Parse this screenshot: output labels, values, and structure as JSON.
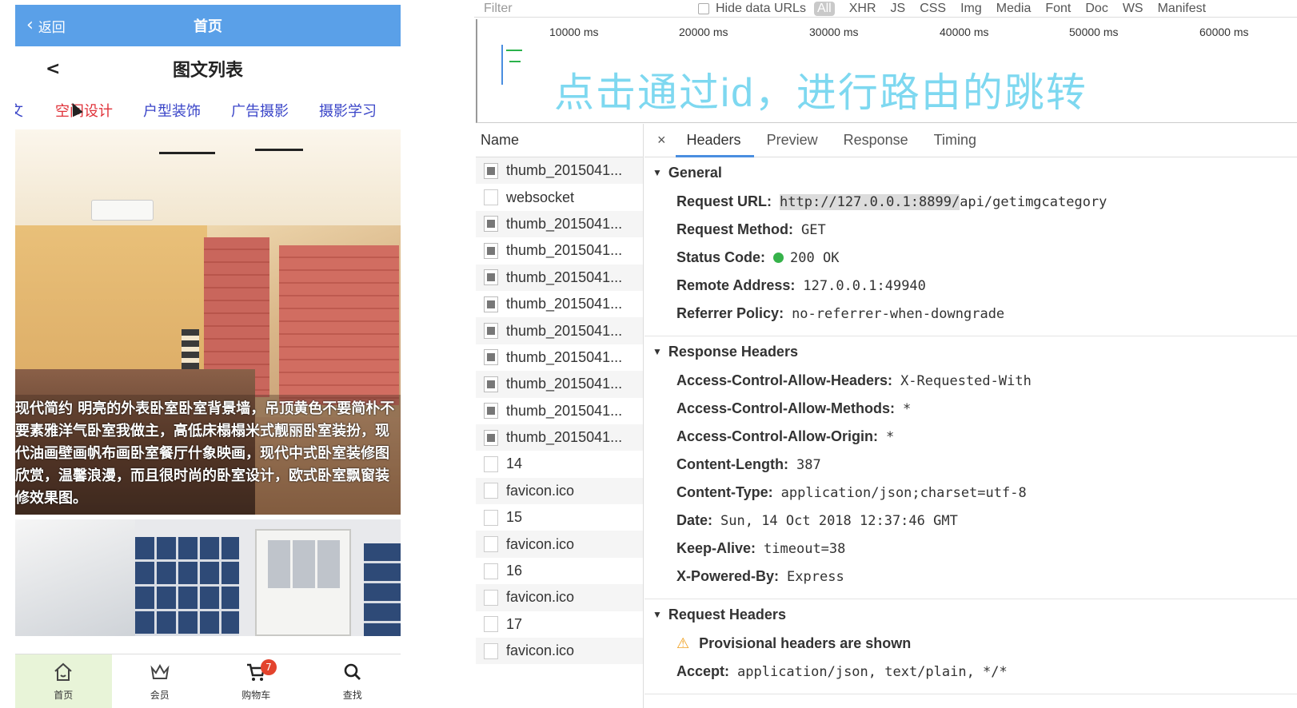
{
  "phone": {
    "navbar": {
      "back_label": "返回",
      "title": "首页"
    },
    "page": {
      "back_label": "<",
      "title": "图文列表"
    },
    "categories": [
      {
        "label": "文"
      },
      {
        "label": "空间设计"
      },
      {
        "label": "户型装饰"
      },
      {
        "label": "广告摄影"
      },
      {
        "label": "摄影学习"
      }
    ],
    "active_category_index": 1,
    "image_caption": "现代简约 明亮的外表卧室卧室背景墙，吊顶黄色不要简朴不要素雅洋气卧室我做主，高低床榻榻米式靓丽卧室装扮，现代油画壁画帆布画卧室餐厅什象映画，现代中式卧室装修图欣赏，温馨浪漫，而且很时尚的卧室设计，欧式卧室飘窗装修效果图。",
    "tabbar": [
      {
        "label": "首页",
        "icon": "home-icon"
      },
      {
        "label": "会员",
        "icon": "crown-icon"
      },
      {
        "label": "购物车",
        "icon": "cart-icon",
        "badge": "7"
      },
      {
        "label": "查找",
        "icon": "search-icon"
      }
    ]
  },
  "devtools": {
    "filter": {
      "placeholder": "Filter",
      "hide_data_urls": "Hide data URLs"
    },
    "types": [
      "All",
      "XHR",
      "JS",
      "CSS",
      "Img",
      "Media",
      "Font",
      "Doc",
      "WS",
      "Manifest"
    ],
    "timeline_ticks": [
      "10000 ms",
      "20000 ms",
      "30000 ms",
      "40000 ms",
      "50000 ms",
      "60000 ms"
    ],
    "overlay_text": "点击通过id，进行路由的跳转",
    "name_header": "Name",
    "requests": [
      {
        "name": "thumb_2015041...",
        "kind": "image"
      },
      {
        "name": "websocket",
        "kind": "plain"
      },
      {
        "name": "thumb_2015041...",
        "kind": "image"
      },
      {
        "name": "thumb_2015041...",
        "kind": "image"
      },
      {
        "name": "thumb_2015041...",
        "kind": "image"
      },
      {
        "name": "thumb_2015041...",
        "kind": "image"
      },
      {
        "name": "thumb_2015041...",
        "kind": "image"
      },
      {
        "name": "thumb_2015041...",
        "kind": "image"
      },
      {
        "name": "thumb_2015041...",
        "kind": "image"
      },
      {
        "name": "thumb_2015041...",
        "kind": "image"
      },
      {
        "name": "thumb_2015041...",
        "kind": "image"
      },
      {
        "name": "14",
        "kind": "plain"
      },
      {
        "name": "favicon.ico",
        "kind": "plain"
      },
      {
        "name": "15",
        "kind": "plain"
      },
      {
        "name": "favicon.ico",
        "kind": "plain"
      },
      {
        "name": "16",
        "kind": "plain"
      },
      {
        "name": "favicon.ico",
        "kind": "plain"
      },
      {
        "name": "17",
        "kind": "plain"
      },
      {
        "name": "favicon.ico",
        "kind": "plain"
      }
    ],
    "detail_tabs": {
      "close": "×",
      "headers": "Headers",
      "preview": "Preview",
      "response": "Response",
      "timing": "Timing"
    },
    "general": {
      "title": "General",
      "request_url_key": "Request URL:",
      "request_url_host": "http://127.0.0.1:8899/",
      "request_url_path": "api/getimgcategory",
      "request_method_key": "Request Method:",
      "request_method": "GET",
      "status_code_key": "Status Code:",
      "status_code": "200 OK",
      "status_color": "#36b24a",
      "remote_address_key": "Remote Address:",
      "remote_address": "127.0.0.1:49940",
      "referrer_policy_key": "Referrer Policy:",
      "referrer_policy": "no-referrer-when-downgrade"
    },
    "response_headers": {
      "title": "Response Headers",
      "items": [
        {
          "key": "Access-Control-Allow-Headers:",
          "value": "X-Requested-With"
        },
        {
          "key": "Access-Control-Allow-Methods:",
          "value": "*"
        },
        {
          "key": "Access-Control-Allow-Origin:",
          "value": "*"
        },
        {
          "key": "Content-Length:",
          "value": "387"
        },
        {
          "key": "Content-Type:",
          "value": "application/json;charset=utf-8"
        },
        {
          "key": "Date:",
          "value": "Sun, 14 Oct 2018 12:37:46 GMT"
        },
        {
          "key": "Keep-Alive:",
          "value": "timeout=38"
        },
        {
          "key": "X-Powered-By:",
          "value": "Express"
        }
      ]
    },
    "request_headers": {
      "title": "Request Headers",
      "warning": "Provisional headers are shown",
      "accept_key": "Accept:",
      "accept_value": "application/json, text/plain, */*"
    }
  }
}
